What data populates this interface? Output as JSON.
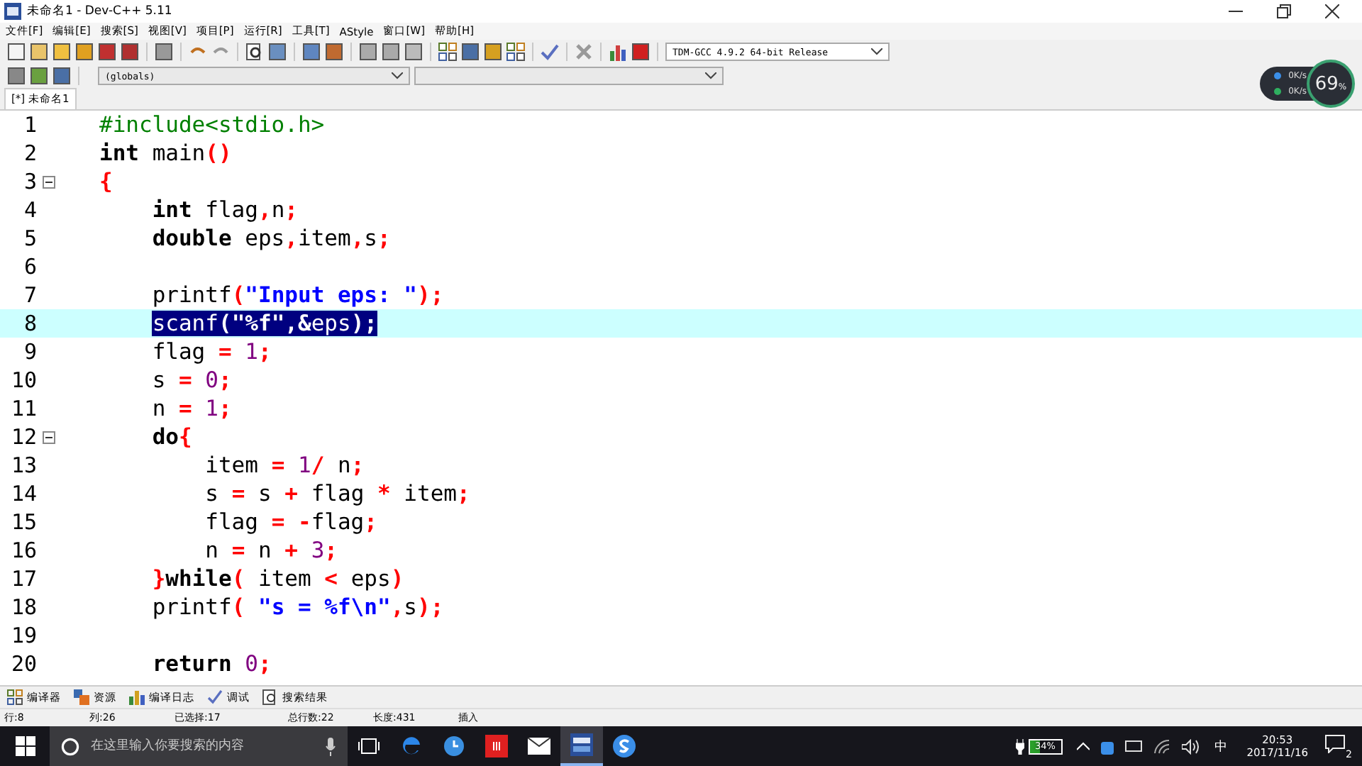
{
  "window": {
    "title": "未命名1 - Dev-C++ 5.11"
  },
  "menu": [
    "文件[F]",
    "编辑[E]",
    "搜索[S]",
    "视图[V]",
    "项目[P]",
    "运行[R]",
    "工具[T]",
    "AStyle",
    "窗口[W]",
    "帮助[H]"
  ],
  "compiler_select": {
    "value": "TDM-GCC 4.9.2 64-bit Release"
  },
  "scope_select": {
    "value": "(globals)"
  },
  "tabs": [
    {
      "label": "[*] 未命名1",
      "selected": true
    }
  ],
  "network_widget": {
    "upload": "0K/s",
    "download": "0K/s",
    "percent": "69",
    "percent_sign": "%"
  },
  "lines": [
    {
      "number": "1",
      "fold": false,
      "current": false,
      "selected": false,
      "tokens": [
        {
          "kind": "pp",
          "text": "#include<stdio.h>"
        }
      ]
    },
    {
      "number": "2",
      "fold": false,
      "current": false,
      "selected": false,
      "tokens": [
        {
          "kind": "kw",
          "text": "int"
        },
        {
          "kind": "id",
          "text": " main"
        },
        {
          "kind": "op",
          "text": "()"
        }
      ]
    },
    {
      "number": "3",
      "fold": true,
      "current": false,
      "selected": false,
      "tokens": [
        {
          "kind": "op",
          "text": "{"
        }
      ],
      "children": [
        {
          "number": "4",
          "fold": false,
          "current": false,
          "selected": false,
          "tokens": [
            {
              "kind": "kw",
              "text": "int"
            },
            {
              "kind": "id",
              "text": " flag"
            },
            {
              "kind": "op",
              "text": ","
            },
            {
              "kind": "id",
              "text": "n"
            },
            {
              "kind": "op",
              "text": ";"
            }
          ]
        },
        {
          "number": "5",
          "fold": false,
          "current": false,
          "selected": false,
          "tokens": [
            {
              "kind": "kw",
              "text": "double"
            },
            {
              "kind": "id",
              "text": " eps"
            },
            {
              "kind": "op",
              "text": ","
            },
            {
              "kind": "id",
              "text": "item"
            },
            {
              "kind": "op",
              "text": ","
            },
            {
              "kind": "id",
              "text": "s"
            },
            {
              "kind": "op",
              "text": ";"
            }
          ]
        },
        {
          "number": "6",
          "fold": false,
          "current": false
        },
        {
          "number": "7",
          "fold": false,
          "current": false,
          "selected": false,
          "tokens": [
            {
              "kind": "id",
              "text": "printf"
            },
            {
              "kind": "op",
              "text": "("
            },
            {
              "kind": "str",
              "text": "\"Input eps: \""
            },
            {
              "kind": "op",
              "text": ");"
            }
          ]
        },
        {
          "number": "8",
          "fold": false,
          "current": true,
          "selected": true,
          "tokens": [
            {
              "kind": "id",
              "text": "scanf"
            },
            {
              "kind": "op",
              "text": "("
            },
            {
              "kind": "str",
              "text": "\"%f\""
            },
            {
              "kind": "op",
              "text": ",&"
            },
            {
              "kind": "id",
              "text": "eps"
            },
            {
              "kind": "op",
              "text": ");"
            }
          ]
        },
        {
          "number": "9",
          "fold": false,
          "current": false,
          "selected": false,
          "tokens": [
            {
              "kind": "id",
              "text": "flag "
            },
            {
              "kind": "op",
              "text": "="
            },
            {
              "kind": "num",
              "text": " 1"
            },
            {
              "kind": "op",
              "text": ";"
            }
          ]
        },
        {
          "number": "10",
          "fold": false,
          "current": false,
          "selected": false,
          "tokens": [
            {
              "kind": "id",
              "text": "s "
            },
            {
              "kind": "op",
              "text": "="
            },
            {
              "kind": "num",
              "text": " 0"
            },
            {
              "kind": "op",
              "text": ";"
            }
          ]
        },
        {
          "number": "11",
          "fold": false,
          "current": false,
          "selected": false,
          "tokens": [
            {
              "kind": "id",
              "text": "n "
            },
            {
              "kind": "op",
              "text": "="
            },
            {
              "kind": "num",
              "text": " 1"
            },
            {
              "kind": "op",
              "text": ";"
            }
          ]
        },
        {
          "number": "12",
          "fold": true,
          "current": false,
          "selected": false,
          "tokens": [
            {
              "kind": "kw",
              "text": "do"
            },
            {
              "kind": "op",
              "text": "{"
            }
          ],
          "children": [
            {
              "number": "13",
              "fold": false,
              "current": false,
              "selected": false,
              "tokens": [
                {
                  "kind": "id",
                  "text": "item "
                },
                {
                  "kind": "op",
                  "text": "="
                },
                {
                  "kind": "num",
                  "text": " 1"
                },
                {
                  "kind": "op",
                  "text": "/"
                },
                {
                  "kind": "id",
                  "text": " n"
                },
                {
                  "kind": "op",
                  "text": ";"
                }
              ]
            },
            {
              "number": "14",
              "fold": false,
              "current": false,
              "selected": false,
              "tokens": [
                {
                  "kind": "id",
                  "text": "s "
                },
                {
                  "kind": "op",
                  "text": "="
                },
                {
                  "kind": "id",
                  "text": " s "
                },
                {
                  "kind": "op",
                  "text": "+"
                },
                {
                  "kind": "id",
                  "text": " flag "
                },
                {
                  "kind": "op",
                  "text": "*"
                },
                {
                  "kind": "id",
                  "text": " item"
                },
                {
                  "kind": "op",
                  "text": ";"
                }
              ]
            },
            {
              "number": "15",
              "fold": false,
              "current": false,
              "selected": false,
              "tokens": [
                {
                  "kind": "id",
                  "text": "flag "
                },
                {
                  "kind": "op",
                  "text": "= -"
                },
                {
                  "kind": "id",
                  "text": "flag"
                },
                {
                  "kind": "op",
                  "text": ";"
                }
              ]
            },
            {
              "number": "16",
              "fold": false,
              "current": false,
              "selected": false,
              "tokens": [
                {
                  "kind": "id",
                  "text": "n "
                },
                {
                  "kind": "op",
                  "text": "="
                },
                {
                  "kind": "id",
                  "text": " n "
                },
                {
                  "kind": "op",
                  "text": "+"
                },
                {
                  "kind": "num",
                  "text": " 3"
                },
                {
                  "kind": "op",
                  "text": ";"
                }
              ]
            }
          ]
        },
        {
          "number": "17",
          "fold": false,
          "current": false,
          "selected": false,
          "tokens": [
            {
              "kind": "op",
              "text": "}"
            },
            {
              "kind": "kw",
              "text": "while"
            },
            {
              "kind": "op",
              "text": "("
            },
            {
              "kind": "id",
              "text": " item "
            },
            {
              "kind": "op",
              "text": "<"
            },
            {
              "kind": "id",
              "text": " eps"
            },
            {
              "kind": "op",
              "text": ")"
            }
          ]
        },
        {
          "number": "18",
          "fold": false,
          "current": false,
          "selected": false,
          "tokens": [
            {
              "kind": "id",
              "text": "printf"
            },
            {
              "kind": "op",
              "text": "("
            },
            {
              "kind": "str",
              "text": " \"s = %f\\n\""
            },
            {
              "kind": "op",
              "text": ","
            },
            {
              "kind": "id",
              "text": "s"
            },
            {
              "kind": "op",
              "text": ");"
            }
          ]
        },
        {
          "number": "19",
          "fold": false,
          "current": false
        },
        {
          "number": "20",
          "fold": false,
          "current": false,
          "selected": false,
          "tokens": [
            {
              "kind": "kw",
              "text": "return"
            },
            {
              "kind": "num",
              "text": " 0"
            },
            {
              "kind": "op",
              "text": ";"
            }
          ]
        }
      ]
    }
  ],
  "bottom_tabs": [
    {
      "kind": "grid",
      "label": "编译器"
    },
    {
      "kind": "res",
      "label": "资源"
    },
    {
      "kind": "chart",
      "label": "编译日志"
    },
    {
      "kind": "check",
      "label": "调试"
    },
    {
      "kind": "find",
      "label": "搜索结果"
    }
  ],
  "status_bar": [
    {
      "label": "行:",
      "value": "8"
    },
    {
      "label": "列:",
      "value": "26"
    },
    {
      "label": "已选择:",
      "value": "17"
    },
    {
      "label": "总行数:",
      "value": "22"
    },
    {
      "label": "长度:",
      "value": "431"
    },
    {
      "label": "插入"
    }
  ],
  "taskbar": {
    "search_placeholder": "在这里输入你要搜索的内容",
    "apps": [
      {
        "kind": "taskview",
        "selected": false
      },
      {
        "kind": "edge",
        "selected": false
      },
      {
        "kind": "clock",
        "selected": false
      },
      {
        "kind": "red",
        "selected": false
      },
      {
        "kind": "mail",
        "selected": false
      },
      {
        "kind": "devcpp",
        "selected": true
      },
      {
        "kind": "sogou",
        "selected": false
      }
    ],
    "battery": {
      "text": "34%",
      "level": 0.34
    },
    "ime": "中",
    "time": "20:53",
    "date": "2017/11/16",
    "notifications": "2"
  }
}
